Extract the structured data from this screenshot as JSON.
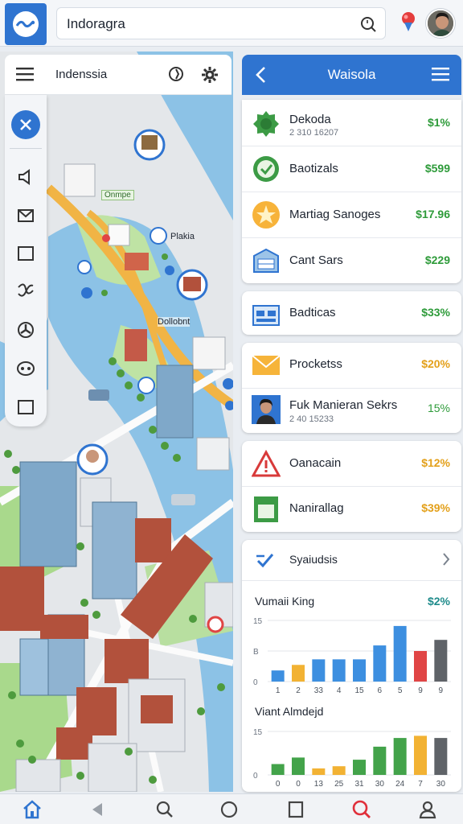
{
  "topbar": {
    "search_value": "Indoragra",
    "search_icon": "search-icon",
    "notification_icon": "notification-pin-icon",
    "avatar": "user-avatar"
  },
  "map_header": {
    "title": "Indenssia"
  },
  "map": {
    "labels": [
      "Onmpe",
      "Plakia",
      "Dollobnt"
    ]
  },
  "panel": {
    "title": "Waisola",
    "items": [
      {
        "name": "Dekoda",
        "sub": "2 310 16207",
        "value": "$1%",
        "icon": "badge-icon"
      },
      {
        "name": "Baotizals",
        "value": "$599",
        "icon": "check-circle-icon"
      },
      {
        "name": "Martiag Sanoges",
        "value": "$17.96",
        "icon": "star-icon"
      },
      {
        "name": "Cant Sars",
        "value": "$229",
        "icon": "building-icon"
      },
      {
        "name": "Badticas",
        "value": "$33%",
        "icon": "calendar-icon"
      },
      {
        "name": "Procketss",
        "value": "$20%",
        "icon": "envelope-icon"
      },
      {
        "name": "Fuk Manieran Sekrs",
        "sub": "2 40 15233",
        "value": "15%",
        "icon": "person-photo-icon"
      },
      {
        "name": "Oanacain",
        "value": "$12%",
        "icon": "warning-icon"
      },
      {
        "name": "Nanirallag",
        "value": "$39%",
        "icon": "document-icon"
      }
    ],
    "link_label": "Syaiudsis",
    "link_icon": "link-icon"
  },
  "chart_data": [
    {
      "type": "bar",
      "title": "Vumaii King",
      "headline": "$2%",
      "yticks": [
        "15",
        "B",
        "0"
      ],
      "categories": [
        "1",
        "2",
        "33",
        "4",
        "15",
        "6",
        "5",
        "9",
        "9"
      ],
      "values": [
        4,
        6,
        8,
        8,
        8,
        13,
        20,
        11,
        15
      ],
      "colors": [
        "#3d8fe0",
        "#f2b233",
        "#3d8fe0",
        "#3d8fe0",
        "#3d8fe0",
        "#3d8fe0",
        "#3d8fe0",
        "#e04545",
        "#5f6368"
      ],
      "ylim": [
        0,
        22
      ]
    },
    {
      "type": "bar",
      "title": "Viant Almdejd",
      "yticks": [
        "15",
        "0"
      ],
      "categories": [
        "0",
        "0",
        "13",
        "25",
        "31",
        "30",
        "24",
        "7",
        "30"
      ],
      "values": [
        5,
        8,
        3,
        4,
        7,
        13,
        17,
        18,
        17
      ],
      "colors": [
        "#43a34a",
        "#43a34a",
        "#f2b233",
        "#f2b233",
        "#43a34a",
        "#43a34a",
        "#43a34a",
        "#f2b233",
        "#5f6368"
      ],
      "ylim": [
        0,
        20
      ]
    }
  ],
  "bottom_nav": [
    "home-icon",
    "back-icon",
    "search-icon",
    "circle-home-icon",
    "recents-icon",
    "search-red-icon",
    "profile-icon"
  ]
}
